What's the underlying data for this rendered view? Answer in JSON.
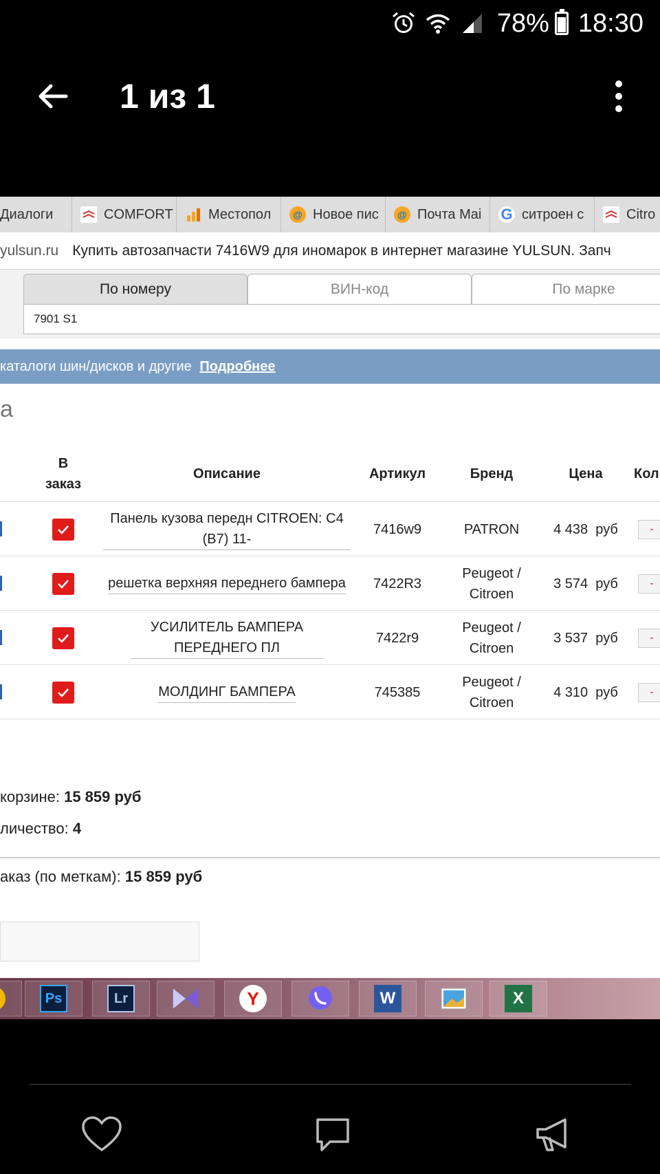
{
  "status_bar": {
    "battery": "78%",
    "time": "18:30"
  },
  "app_bar": {
    "title": "1 из 1"
  },
  "browser": {
    "tabs": [
      {
        "label": "Диалоги",
        "icon": "none"
      },
      {
        "label": "COMFORT",
        "icon": "citroen-icon"
      },
      {
        "label": "Местопол",
        "icon": "bars-icon"
      },
      {
        "label": "Новое пис",
        "icon": "mail-at-icon"
      },
      {
        "label": "Почта Mai",
        "icon": "mail-at-icon"
      },
      {
        "label": "ситроен с",
        "icon": "google-icon"
      },
      {
        "label": "Citro",
        "icon": "citroen-icon"
      }
    ],
    "address": {
      "domain": "yulsun.ru",
      "page_title": "Купить автозапчасти 7416W9 для иномарок в интернет магазине YULSUN. Запч"
    }
  },
  "search": {
    "tabs": [
      "По номеру",
      "ВИН-код",
      "По марке"
    ],
    "active_tab": 0,
    "value": "7901 S1"
  },
  "banner": {
    "text": "каталоги шин/дисков и другие",
    "link": "Подробнее"
  },
  "heading_fragment": "а",
  "table": {
    "headers": {
      "order": "В\nзаказ",
      "description": "Описание",
      "article": "Артикул",
      "brand": "Бренд",
      "price": "Цена",
      "qty": "Кол"
    },
    "rows": [
      {
        "description": "Панель кузова передн CITROEN: C4 (B7) 11-",
        "article": "7416w9",
        "brand": "PATRON",
        "price": "4 438",
        "currency": "руб",
        "qty_btn": "-"
      },
      {
        "description": "решетка верхняя переднего бампера",
        "article": "7422R3",
        "brand": "Peugeot / Citroen",
        "price": "3 574",
        "currency": "руб",
        "qty_btn": "-"
      },
      {
        "description": "УСИЛИТЕЛЬ БАМПЕРА ПЕРЕДНЕГО ПЛ",
        "article": "7422r9",
        "brand": "Peugeot / Citroen",
        "price": "3 537",
        "currency": "руб",
        "qty_btn": "-"
      },
      {
        "description": "МОЛДИНГ БАМПЕРА",
        "article": "745385",
        "brand": "Peugeot / Citroen",
        "price": "4 310",
        "currency": "руб",
        "qty_btn": "-"
      }
    ]
  },
  "summary": {
    "cart_label": "корзине:",
    "cart_total": "15 859  руб",
    "qty_label": "личество:",
    "qty_value": "4",
    "order_label": "аказ (по меткам):",
    "order_total": "15 859  руб"
  },
  "taskbar": {
    "apps": [
      {
        "name": "chrome-icon",
        "label": ""
      },
      {
        "name": "photoshop-icon",
        "label": "Ps"
      },
      {
        "name": "lightroom-icon",
        "label": "Lr"
      },
      {
        "name": "media-player-icon",
        "label": ""
      },
      {
        "name": "yandex-browser-icon",
        "label": "Y"
      },
      {
        "name": "viber-icon",
        "label": ""
      },
      {
        "name": "word-icon",
        "label": "W"
      },
      {
        "name": "image-viewer-icon",
        "label": ""
      },
      {
        "name": "excel-icon",
        "label": "X"
      }
    ]
  },
  "colors": {
    "banner": "#7a9dc4",
    "checkbox": "#e01b1b",
    "app_background": "#000000"
  }
}
